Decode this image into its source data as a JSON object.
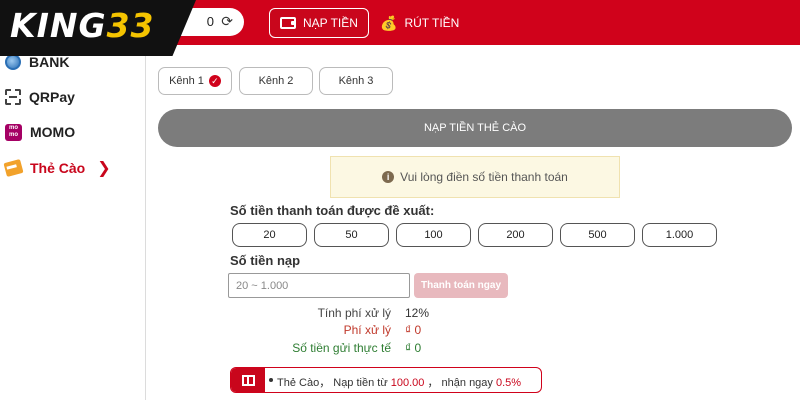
{
  "header": {
    "logo": {
      "text": "KING",
      "num": "33"
    },
    "balance": "0",
    "tabs": {
      "deposit": "NẠP TIỀN",
      "withdraw": "RÚT TIỀN"
    }
  },
  "sidebar": {
    "items": [
      {
        "label": "BANK"
      },
      {
        "label": "QRPay"
      },
      {
        "label": "MOMO"
      },
      {
        "label": "Thẻ Cào"
      }
    ]
  },
  "channels": [
    "Kênh 1",
    "Kênh 2",
    "Kênh 3"
  ],
  "section_title": "NẠP TIỀN THẺ CÀO",
  "notice": "Vui lòng điền số tiền thanh toán",
  "suggest_label": "Số tiền thanh toán được đề xuất:",
  "amounts": [
    "20",
    "50",
    "100",
    "200",
    "500",
    "1.000"
  ],
  "deposit_label": "Số tiền nạp",
  "input": {
    "placeholder": "20 ~ 1.000"
  },
  "pay_button": "Thanh toán ngay",
  "fees": {
    "fee_rate_label": "Tính phí xử lý",
    "fee_rate_value": "12%",
    "fee_label": "Phí xử lý",
    "fee_value": "₫ 0",
    "actual_label": "Số tiền gửi thực tế",
    "actual_value": "₫ 0"
  },
  "promo": {
    "prefix": "Thẻ Cào， Nạp tiền từ",
    "min": "100.00",
    "mid": "， nhận ngay",
    "rate": "0.5%"
  },
  "colors": {
    "brand_red": "#d0021b",
    "fee_red": "#c0392b",
    "actual_green": "#2e7d32",
    "section_gray": "#7c7c7c"
  }
}
